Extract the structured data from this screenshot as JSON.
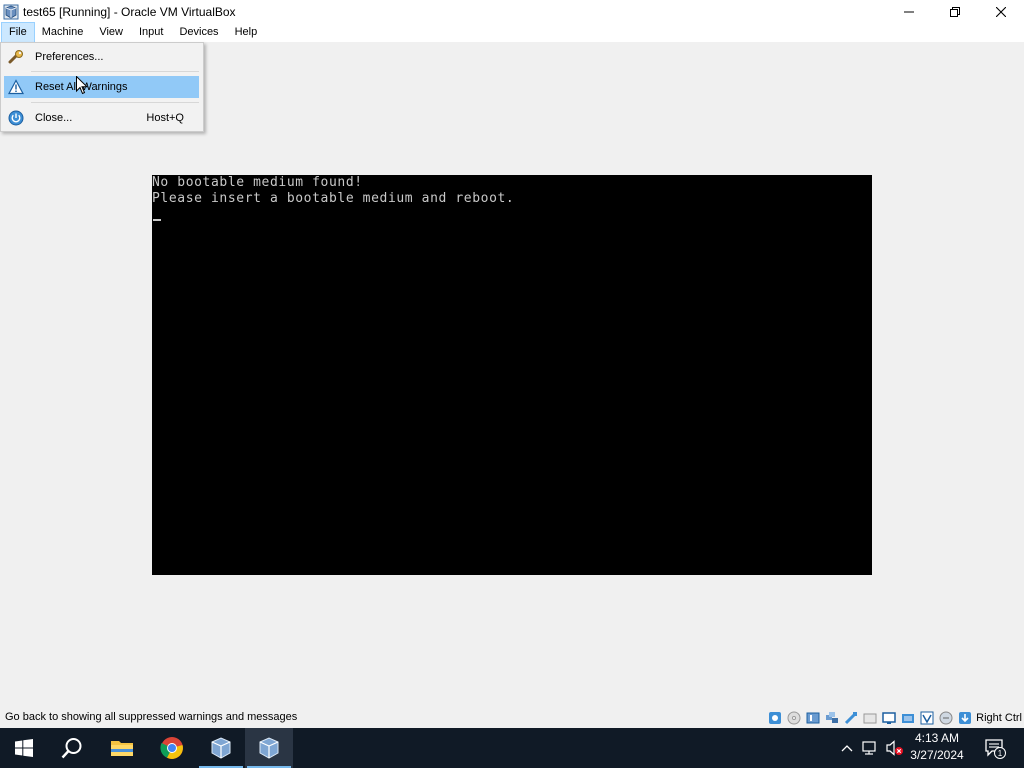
{
  "window": {
    "title": "test65 [Running] - Oracle VM VirtualBox"
  },
  "menubar": {
    "items": [
      "File",
      "Machine",
      "View",
      "Input",
      "Devices",
      "Help"
    ],
    "active": "File"
  },
  "file_menu": {
    "items": [
      {
        "label": "Preferences...",
        "icon": "wrench-icon",
        "shortcut": ""
      },
      {
        "label": "Reset All Warnings",
        "icon": "warning-icon",
        "shortcut": "",
        "highlighted": true
      },
      {
        "label": "Close...",
        "icon": "power-icon",
        "shortcut": "Host+Q"
      }
    ]
  },
  "vm_screen": {
    "lines": [
      "No bootable medium found!",
      "Please insert a bootable medium and reboot."
    ]
  },
  "statusbar": {
    "message": "Go back to showing all suppressed warnings and messages",
    "host_key": "Right Ctrl",
    "indicators": [
      "hard-disk-icon",
      "optical-drive-icon",
      "audio-icon",
      "network-icon",
      "usb-icon",
      "shared-folders-icon",
      "display-icon",
      "video-capture-icon",
      "virtualization-icon",
      "cpu-icon",
      "mouse-integration-icon",
      "keyboard-capture-icon"
    ]
  },
  "taskbar": {
    "apps": [
      "start-icon",
      "search-icon",
      "file-explorer-icon",
      "chrome-icon",
      "virtualbox-icon",
      "virtualbox-vm-icon"
    ],
    "clock_time": "4:13 AM",
    "clock_date": "3/27/2024",
    "notification_count": "1"
  },
  "colors": {
    "menu_highlight": "#91c9f7",
    "taskbar_bg": "#101a26",
    "vm_screen_bg": "#000000",
    "vm_text": "#c8c8c8"
  }
}
